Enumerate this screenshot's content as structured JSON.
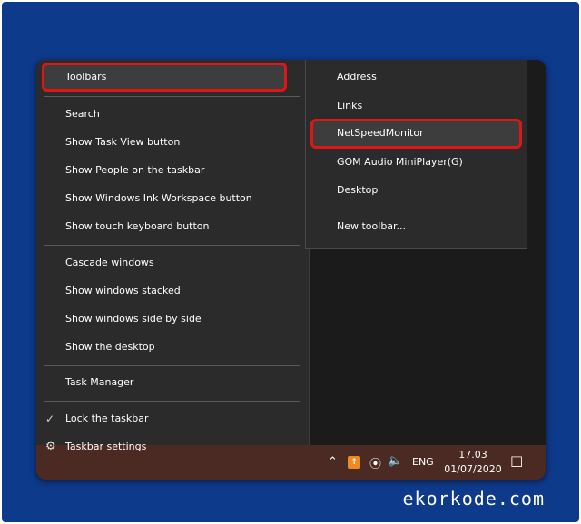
{
  "context_menu": {
    "items": [
      {
        "label": "Toolbars"
      },
      {
        "label": "Search"
      },
      {
        "label": "Show Task View button"
      },
      {
        "label": "Show People on the taskbar"
      },
      {
        "label": "Show Windows Ink Workspace button"
      },
      {
        "label": "Show touch keyboard button"
      },
      {
        "label": "Cascade windows"
      },
      {
        "label": "Show windows stacked"
      },
      {
        "label": "Show windows side by side"
      },
      {
        "label": "Show the desktop"
      },
      {
        "label": "Task Manager"
      },
      {
        "label": "Lock the taskbar"
      },
      {
        "label": "Taskbar settings"
      }
    ]
  },
  "toolbars_submenu": {
    "items": [
      {
        "label": "Address"
      },
      {
        "label": "Links"
      },
      {
        "label": "NetSpeedMonitor"
      },
      {
        "label": "GOM Audio MiniPlayer(G)"
      },
      {
        "label": "Desktop"
      },
      {
        "label": "New toolbar..."
      }
    ]
  },
  "taskbar": {
    "language": "ENG",
    "time": "17.03",
    "date": "01/07/2020"
  },
  "watermark": "ekorkode.com",
  "colors": {
    "frame": "#0e3a8c",
    "menu_bg": "#2b2b2b",
    "highlight_red": "#e01616",
    "taskbar": "#4a2a22"
  }
}
